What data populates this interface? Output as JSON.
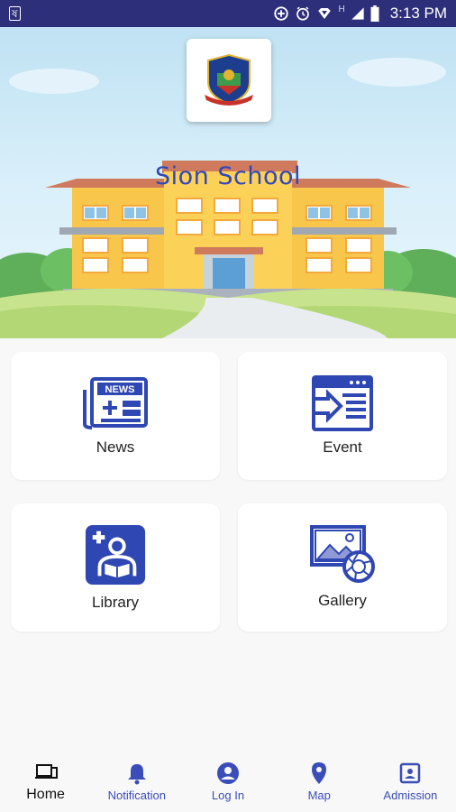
{
  "status_bar": {
    "left_glyph": "ষ",
    "time": "3:13 PM",
    "network": "H",
    "icons": [
      "data-saver-icon",
      "alarm-icon",
      "vpn-key-icon",
      "signal-icon",
      "battery-icon"
    ]
  },
  "hero": {
    "school_name": "Sion School",
    "logo_icon": "school-crest-icon"
  },
  "tiles": [
    {
      "label": "News",
      "icon": "newspaper-icon"
    },
    {
      "label": "Event",
      "icon": "event-window-icon"
    },
    {
      "label": "Library",
      "icon": "library-reader-icon"
    },
    {
      "label": "Gallery",
      "icon": "gallery-camera-icon"
    }
  ],
  "bottom_nav": {
    "active": "Home",
    "items": [
      {
        "label": "Home",
        "icon": "devices-icon"
      },
      {
        "label": "Notification",
        "icon": "bell-icon"
      },
      {
        "label": "Log In",
        "icon": "account-circle-icon"
      },
      {
        "label": "Map",
        "icon": "map-pin-icon"
      },
      {
        "label": "Admission",
        "icon": "id-card-icon"
      }
    ]
  },
  "colors": {
    "status_bar": "#2d2f7a",
    "accent": "#3a4db8",
    "icon_blue": "#2f47b3"
  }
}
